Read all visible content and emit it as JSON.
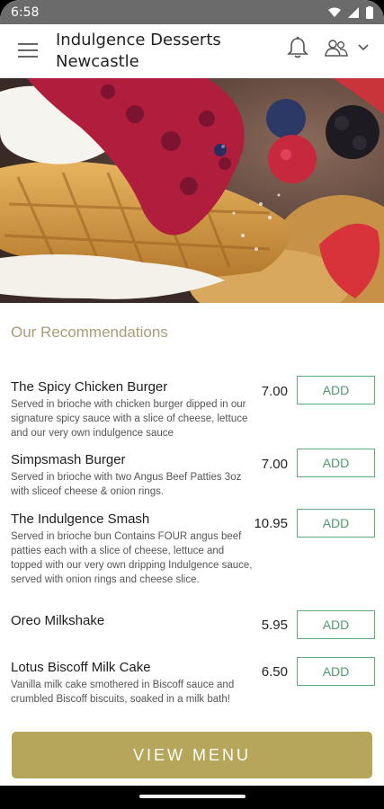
{
  "status_bar": {
    "time": "6:58"
  },
  "header": {
    "title_line1": "Indulgence Desserts",
    "title_line2": "Newcastle"
  },
  "recommendations": {
    "title": "Our Recommendations",
    "add_label": "ADD",
    "items": [
      {
        "name": "The Spicy Chicken Burger",
        "description": "Served in brioche with chicken burger dipped in our signature spicy sauce with a slice of cheese, lettuce and our very own indulgence sauce",
        "price": "7.00"
      },
      {
        "name": "Simpsmash Burger",
        "description": "Served in brioche with two Angus Beef Patties 3oz with sliceof cheese & onion rings.",
        "price": "7.00"
      },
      {
        "name": "The Indulgence Smash",
        "description": "Served in brioche bun Contains FOUR angus beef patties each with a slice of cheese, lettuce and topped with our very own dripping Indulgence sauce, served with onion rings and cheese slice.",
        "price": "10.95"
      },
      {
        "name": "Oreo Milkshake",
        "description": "",
        "price": "5.95"
      },
      {
        "name": "Lotus Biscoff Milk Cake",
        "description": "Vanilla milk cake smothered in Biscoff sauce and crumbled Biscoff biscuits, soaked in a milk bath!",
        "price": "6.50"
      }
    ]
  },
  "view_menu_label": "VIEW MENU",
  "icons": {
    "menu": "hamburger-icon",
    "notifications": "bell-icon",
    "user": "user-group-icon",
    "dropdown": "chevron-down-icon"
  },
  "colors": {
    "accent_gold": "#b5a65a",
    "section_title": "#a99c7a",
    "add_button": "#5fa97a"
  }
}
